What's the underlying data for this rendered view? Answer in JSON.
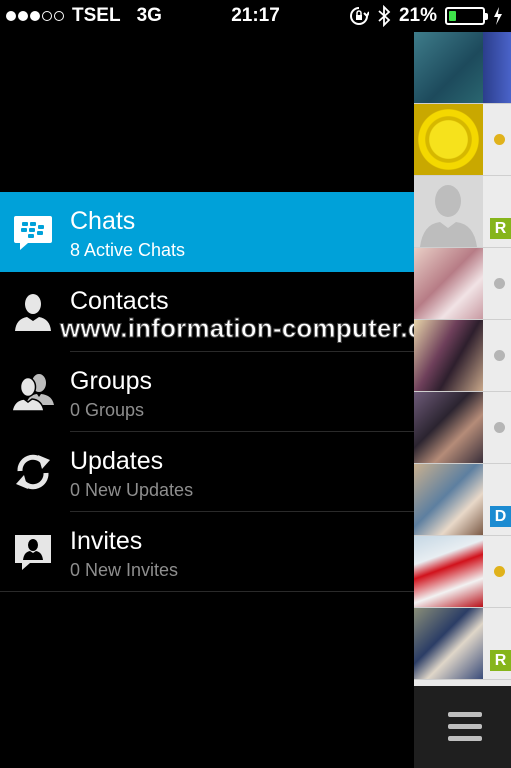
{
  "status_bar": {
    "carrier": "TSEL",
    "network": "3G",
    "time": "21:17",
    "battery_percent": "21%",
    "battery_level": 0.21,
    "signal_strength_of_5": 3,
    "icons": [
      "orientation-lock-icon",
      "bluetooth-icon",
      "battery-icon",
      "charging-icon"
    ]
  },
  "menu": {
    "items": [
      {
        "title": "Chats",
        "subtitle": "8 Active Chats",
        "icon": "bbm-logo-icon",
        "active": true
      },
      {
        "title": "Contacts",
        "subtitle": "",
        "icon": "contact-person-icon",
        "active": false
      },
      {
        "title": "Groups",
        "subtitle": "0 Groups",
        "icon": "groups-icon",
        "active": false
      },
      {
        "title": "Updates",
        "subtitle": "0 New Updates",
        "icon": "refresh-icon",
        "active": false
      },
      {
        "title": "Invites",
        "subtitle": "0 New Invites",
        "icon": "invite-icon",
        "active": false
      }
    ]
  },
  "watermark": "www.information-computer.com",
  "chat_list_peek": [
    {
      "badge": "none"
    },
    {
      "badge": "dot",
      "badge_color": "#e0b21b"
    },
    {
      "badge": "R",
      "badge_color": "#86b51b"
    },
    {
      "badge": "dot",
      "badge_color": "#b5b5b5"
    },
    {
      "badge": "dot",
      "badge_color": "#b5b5b5"
    },
    {
      "badge": "dot",
      "badge_color": "#b5b5b5"
    },
    {
      "badge": "D",
      "badge_color": "#1c8bd1"
    },
    {
      "badge": "dot",
      "badge_color": "#e0b21b"
    },
    {
      "badge": "R",
      "badge_color": "#86b51b"
    }
  ],
  "colors": {
    "active_highlight": "#00a1d9",
    "background": "#000000",
    "secondary_text": "#8e8e8e",
    "battery_fill": "#3fe24a"
  }
}
